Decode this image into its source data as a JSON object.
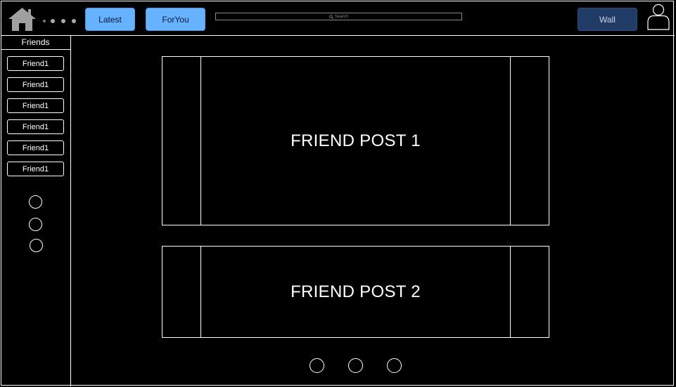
{
  "header": {
    "latest_label": "Latest",
    "foryou_label": "ForYou",
    "search_placeholder": "Search",
    "wall_label": "Wall"
  },
  "sidebar": {
    "title": "Friends",
    "friends": [
      "Friend1",
      "Friend1",
      "Friend1",
      "Friend1",
      "Friend1",
      "Friend1"
    ]
  },
  "posts": [
    {
      "text": "FRIEND POST 1"
    },
    {
      "text": "FRIEND POST 2"
    }
  ],
  "colors": {
    "background": "#000000",
    "button_primary": "#66b2ff",
    "button_wall": "#1f3b66"
  },
  "icons": [
    "home-icon",
    "search-icon",
    "user-avatar-icon"
  ]
}
